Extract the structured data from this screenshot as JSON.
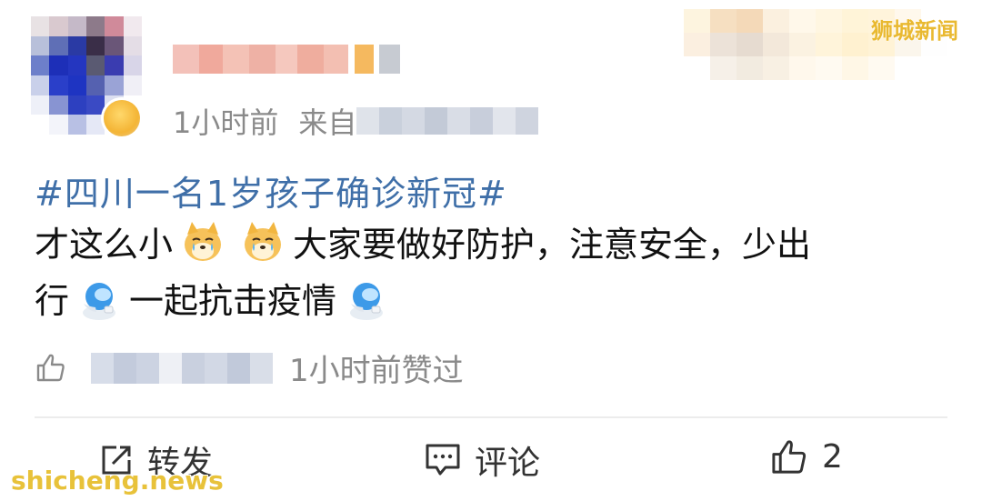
{
  "header": {
    "meta_time": "1小时前",
    "meta_from": "来自"
  },
  "post": {
    "hashtag": "#四川一名1岁孩子确诊新冠#",
    "text_1": "才这么小",
    "text_2": "大家要做好防护，注意安全，少出",
    "text_3": "行",
    "text_4": "一起抗击疫情"
  },
  "liked": {
    "time_text": "1小时前赞过"
  },
  "actions": {
    "repost_label": "转发",
    "comment_label": "评论",
    "like_count": "2"
  },
  "watermarks": {
    "top": "狮城新闻",
    "bottom": "shicheng.news"
  },
  "colors": {
    "hashtag": "#3f6fa8",
    "meta": "#8a8a8a",
    "watermark": "#e9b931"
  }
}
